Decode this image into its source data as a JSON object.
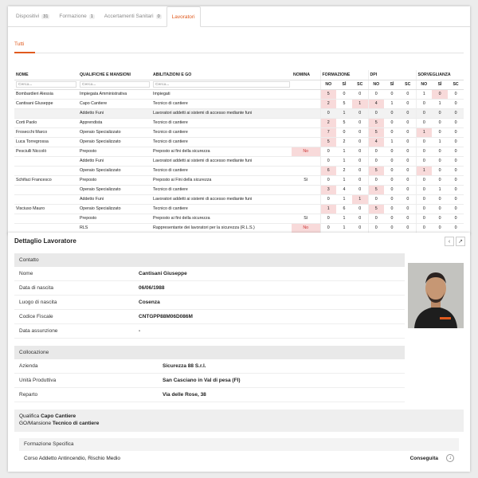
{
  "tabs": [
    {
      "label": "Dispositivi",
      "count": "31"
    },
    {
      "label": "Formazione",
      "count": "1"
    },
    {
      "label": "Accertamenti Sanitari",
      "count": "0"
    },
    {
      "label": "Lavoratori",
      "count": ""
    }
  ],
  "subtab": "Tutti",
  "table": {
    "headers": {
      "nome": "NOME",
      "qualifiche": "QUALIFICHE E MANSIONI",
      "abilitazioni": "ABILITAZIONI E GO",
      "nomina": "NOMINA",
      "formazione": "FORMAZIONE",
      "dpi": "DPI",
      "sorveglianza": "SORVEGLIANZA",
      "sub": [
        "NO",
        "SÌ",
        "SC"
      ]
    },
    "filter_placeholder": "Cerca...",
    "rows": [
      {
        "nome": "Bombardieri Alessia",
        "qual": "Impiegata Amministrativa",
        "abil": "Impiegati",
        "nomina": "",
        "f": [
          "5",
          "0",
          "0"
        ],
        "d": [
          "0",
          "0",
          "0"
        ],
        "s": [
          "1",
          "0",
          "0"
        ],
        "hl": [
          0,
          7
        ]
      },
      {
        "nome": "Cantisani GIuseppe",
        "qual": "Capo Cantiere",
        "abil": "Tecnico di cantiere",
        "nomina": "",
        "f": [
          "2",
          "5",
          "1"
        ],
        "d": [
          "4",
          "1",
          "0"
        ],
        "s": [
          "0",
          "1",
          "0"
        ],
        "hl": [
          0,
          2,
          3
        ]
      },
      {
        "nome": "",
        "qual": "Addetto Funi",
        "abil": "Lavoratori addetti ai sistemi di accesso mediante funi",
        "nomina": "",
        "f": [
          "0",
          "1",
          "0"
        ],
        "d": [
          "0",
          "0",
          "0"
        ],
        "s": [
          "0",
          "0",
          "0"
        ],
        "hl": [],
        "sel": true
      },
      {
        "nome": "Corti Paolo",
        "qual": "Apprendista",
        "abil": "Tecnico di cantiere",
        "nomina": "",
        "f": [
          "2",
          "5",
          "0"
        ],
        "d": [
          "5",
          "0",
          "0"
        ],
        "s": [
          "0",
          "0",
          "0"
        ],
        "hl": [
          0,
          3
        ]
      },
      {
        "nome": "Frosecchi Marco",
        "qual": "Operaio Specializzato",
        "abil": "Tecnico di cantiere",
        "nomina": "",
        "f": [
          "7",
          "0",
          "0"
        ],
        "d": [
          "5",
          "0",
          "0"
        ],
        "s": [
          "1",
          "0",
          "0"
        ],
        "hl": [
          0,
          3,
          6
        ]
      },
      {
        "nome": "Luca Torregrossa",
        "qual": "Operaio Specializzato",
        "abil": "Tecnico di cantiere",
        "nomina": "",
        "f": [
          "5",
          "2",
          "0"
        ],
        "d": [
          "4",
          "1",
          "0"
        ],
        "s": [
          "0",
          "1",
          "0"
        ],
        "hl": [
          0,
          3
        ]
      },
      {
        "nome": "Pesciulli Niccolò",
        "qual": "Preposto",
        "abil": "Preposto ai fini della sicurezza",
        "nomina": "No",
        "f": [
          "0",
          "1",
          "0"
        ],
        "d": [
          "0",
          "0",
          "0"
        ],
        "s": [
          "0",
          "0",
          "0"
        ],
        "hl": []
      },
      {
        "nome": "",
        "qual": "Addetto Funi",
        "abil": "Lavoratori addetti ai sistemi di accesso mediante funi",
        "nomina": "",
        "f": [
          "0",
          "1",
          "0"
        ],
        "d": [
          "0",
          "0",
          "0"
        ],
        "s": [
          "0",
          "0",
          "0"
        ],
        "hl": []
      },
      {
        "nome": "",
        "qual": "Operaio Specializzato",
        "abil": "Tecnico di cantiere",
        "nomina": "",
        "f": [
          "6",
          "2",
          "0"
        ],
        "d": [
          "5",
          "0",
          "0"
        ],
        "s": [
          "1",
          "0",
          "0"
        ],
        "hl": [
          0,
          3,
          6
        ]
      },
      {
        "nome": "Schifaci Francesco",
        "qual": "Preposto",
        "abil": "Preposto ai Fini della sicurezza",
        "nomina": "Sì",
        "f": [
          "0",
          "1",
          "0"
        ],
        "d": [
          "0",
          "0",
          "0"
        ],
        "s": [
          "0",
          "0",
          "0"
        ],
        "hl": []
      },
      {
        "nome": "",
        "qual": "Operaio Specializzato",
        "abil": "Tecnico di cantiere",
        "nomina": "",
        "f": [
          "3",
          "4",
          "0"
        ],
        "d": [
          "5",
          "0",
          "0"
        ],
        "s": [
          "0",
          "1",
          "0"
        ],
        "hl": [
          0,
          3
        ]
      },
      {
        "nome": "",
        "qual": "Addetto Funi",
        "abil": "Lavoratori addetti ai sistemi di accesso mediante funi",
        "nomina": "",
        "f": [
          "0",
          "1",
          "1"
        ],
        "d": [
          "0",
          "0",
          "0"
        ],
        "s": [
          "0",
          "0",
          "0"
        ],
        "hl": [
          2
        ]
      },
      {
        "nome": "Visciuso Mauro",
        "qual": "Operaio Specializzato",
        "abil": "Tecnico di cantiere",
        "nomina": "",
        "f": [
          "1",
          "6",
          "0"
        ],
        "d": [
          "5",
          "0",
          "0"
        ],
        "s": [
          "0",
          "0",
          "0"
        ],
        "hl": [
          0,
          3
        ]
      },
      {
        "nome": "",
        "qual": "Preposto",
        "abil": "Preposto ai fini della sicurezza",
        "nomina": "Sì",
        "f": [
          "0",
          "1",
          "0"
        ],
        "d": [
          "0",
          "0",
          "0"
        ],
        "s": [
          "0",
          "0",
          "0"
        ],
        "hl": []
      },
      {
        "nome": "",
        "qual": "RLS",
        "abil": "Rappresentante dei lavoratori per la sicurezza (R.L.S.)",
        "nomina": "No",
        "f": [
          "0",
          "1",
          "0"
        ],
        "d": [
          "0",
          "0",
          "0"
        ],
        "s": [
          "0",
          "0",
          "0"
        ],
        "hl": []
      }
    ]
  },
  "detail": {
    "title": "Dettaglio Lavoratore",
    "contatto": {
      "head": "Contatto",
      "fields": [
        {
          "label": "Nome",
          "value": "Cantisani Giuseppe"
        },
        {
          "label": "Data di nascita",
          "value": "06/06/1988"
        },
        {
          "label": "Luogo di nascita",
          "value": "Cosenza"
        },
        {
          "label": "Codice Fiscale",
          "value": "CNTGPP88M06D086M"
        },
        {
          "label": "Data assunzione",
          "value": "-"
        }
      ]
    },
    "collocazione": {
      "head": "Collocazione",
      "fields": [
        {
          "label": "Azienda",
          "value": "Sicurezza 88 S.r.l."
        },
        {
          "label": "Unità Produttiva",
          "value": "San Casciano in Val di pesa (FI)"
        },
        {
          "label": "Reparto",
          "value": "Via delle Rose, 38"
        }
      ]
    },
    "qualifica_label": "Qualifica",
    "qualifica_value": "Capo Cantiere",
    "mansione_label": "GO/Mansione",
    "mansione_value": "Tecnico di cantiere",
    "formazione": {
      "head": "Formazione Specifica",
      "course": "Corso Addetto Antincendio, Rischio Medio",
      "status": "Conseguita"
    }
  },
  "colors": {
    "accent": "#e05a1e",
    "highlight": "#f8dada"
  }
}
